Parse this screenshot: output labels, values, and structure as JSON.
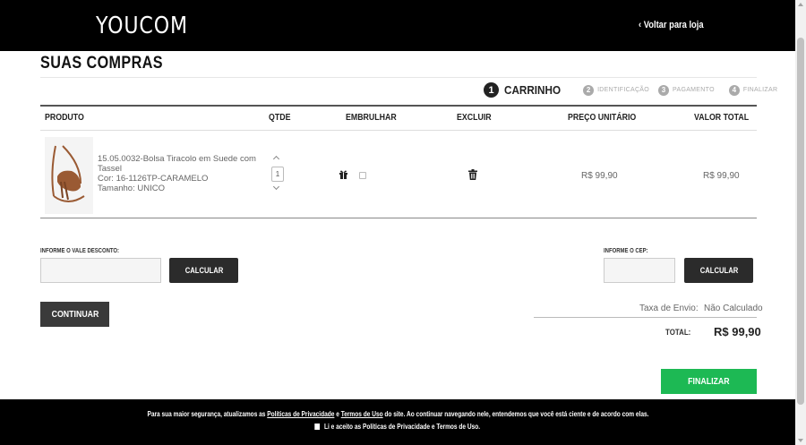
{
  "header": {
    "logo": "YOUCOM",
    "back_link": "‹ Voltar para loja"
  },
  "page_title": "SUAS COMPRAS",
  "steps": [
    {
      "num": "1",
      "label": "CARRINHO",
      "active": true
    },
    {
      "num": "2",
      "label": "IDENTIFICAÇÃO",
      "active": false
    },
    {
      "num": "3",
      "label": "PAGAMENTO",
      "active": false
    },
    {
      "num": "4",
      "label": "FINALIZAR",
      "active": false
    }
  ],
  "table": {
    "headers": {
      "produto": "PRODUTO",
      "qtde": "QTDE",
      "embrulhar": "EMBRULHAR",
      "excluir": "EXCLUIR",
      "preco_unitario": "PREÇO UNITÁRIO",
      "valor_total": "VALOR TOTAL"
    },
    "items": [
      {
        "name": "15.05.0032-Bolsa Tiracolo em Suede com Tassel",
        "color": "Cor: 16-1126TP-CARAMELO",
        "size": "Tamanho: UNICO",
        "qty": "1",
        "unit_price": "R$ 99,90",
        "total_price": "R$ 99,90",
        "image_color": "#9a5a33"
      }
    ]
  },
  "discount": {
    "label": "INFORME O VALE DESCONTO:",
    "value": "",
    "button": "CALCULAR"
  },
  "cep": {
    "label": "INFORME O CEP:",
    "value": "",
    "button": "CALCULAR"
  },
  "continue_button": "CONTINUAR",
  "summary": {
    "shipping_label": "Taxa de Envio:",
    "shipping_value": "Não Calculado",
    "total_label": "TOTAL:",
    "total_value": "R$ 99,90"
  },
  "finalize_button": "FINALIZAR",
  "footer": {
    "text_before": "Para sua maior segurança, atualizamos as ",
    "privacy_link": "Políticas de Privacidade",
    "text_and": " e ",
    "terms_link": "Termos de Uso",
    "text_after": " do site. Ao continuar navegando nele, entendemos que você está ciente e de acordo com elas.",
    "accept_label": "Li e aceito as Políticas de Privacidade e Termos de Uso."
  },
  "colors": {
    "header_bg": "#000000",
    "finalize_green": "#1db954",
    "dark_button": "#2b2b2b"
  }
}
